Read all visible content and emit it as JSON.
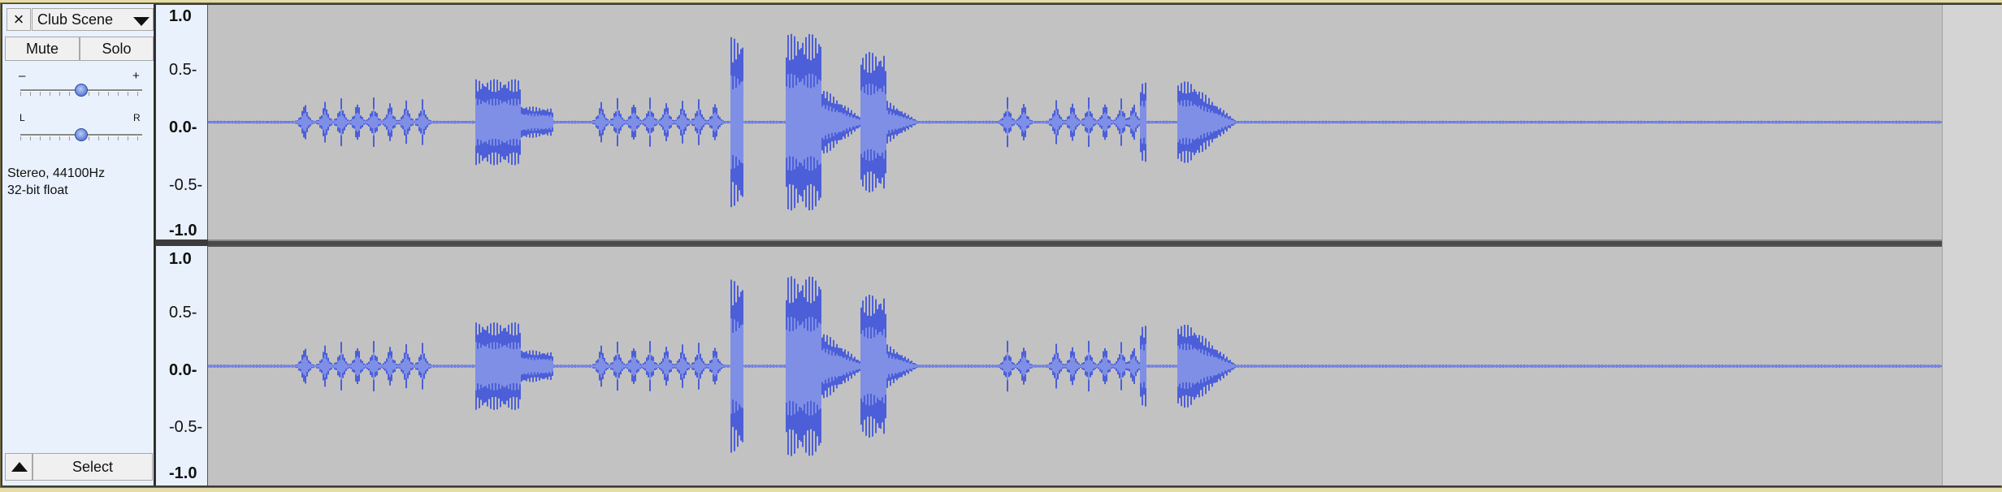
{
  "track": {
    "close_glyph": "×",
    "name": "Club Scene",
    "mute_label": "Mute",
    "solo_label": "Solo",
    "gain_minus": "–",
    "gain_plus": "+",
    "gain_level": 0.5,
    "pan_left": "L",
    "pan_right": "R",
    "pan_level": 0.5,
    "info_line1": "Stereo, 44100Hz",
    "info_line2": "32-bit float",
    "select_label": "Select"
  },
  "ruler": {
    "labels": [
      "1.0",
      "0.5-",
      "0.0-",
      "-0.5-",
      "-1.0"
    ]
  },
  "colors": {
    "waveform": "#4c5fd8",
    "waveform_rms": "#7f8fe6",
    "background": "#c2c2c2",
    "panel": "#e9f1fd"
  },
  "icons": {
    "close": "close-icon",
    "dropdown": "chevron-down-icon",
    "collapse": "collapse-arrow-icon"
  }
}
